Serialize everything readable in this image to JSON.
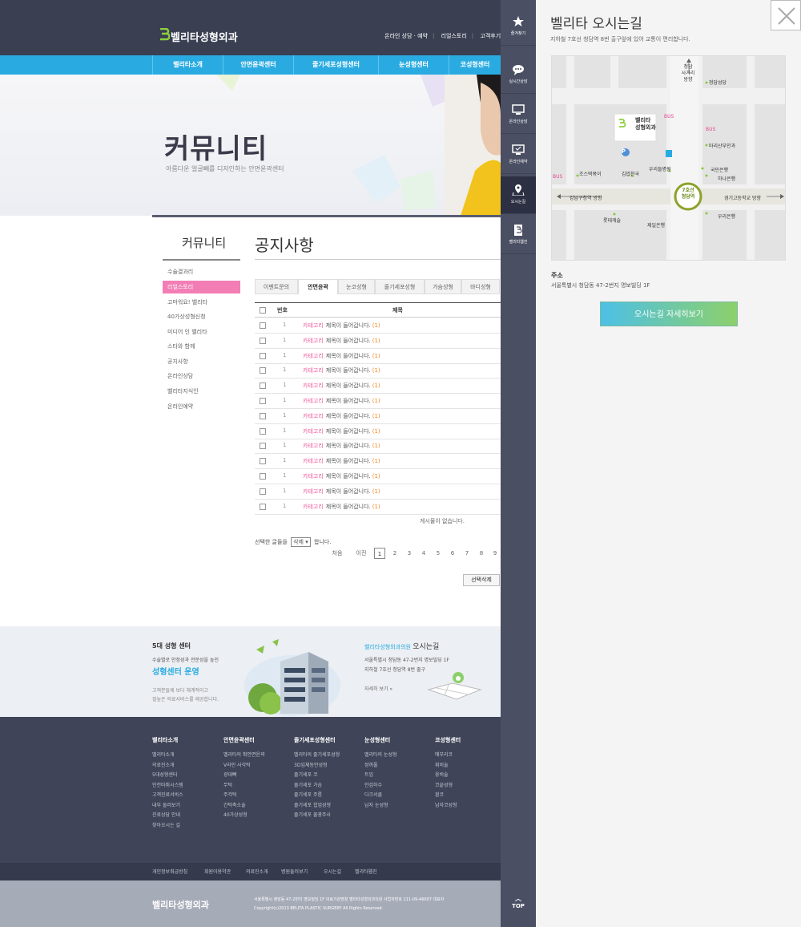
{
  "header": {
    "logo": "벨리타성형외과",
    "util": [
      "온라인 상담 · 예약",
      "리얼스토리",
      "고객후기"
    ]
  },
  "gnb": [
    "벨리타소개",
    "안면윤곽센터",
    "줄기세포성형센터",
    "눈성형센터",
    "코성형센터"
  ],
  "visual": {
    "title": "커뮤니티",
    "subtitle": "아름다운 얼굴빼를 디자인하는 안면윤곽센터"
  },
  "lnb": {
    "title": "커뮤니티",
    "items": [
      "수술결과리",
      "리얼스토리",
      "고마워요! 벨리타",
      "40가상성형신청",
      "미디어 인 벨리타",
      "스타와 함께",
      "공지사항",
      "온라인상담",
      "벨리타지식인",
      "온라인예약"
    ]
  },
  "main": {
    "page_title": "공지사항",
    "tabs": [
      "이벤트문의",
      "안면윤곽",
      "눈코성형",
      "줄기세포성형",
      "가슴성형",
      "바디성형"
    ],
    "table_header": {
      "num": "번호",
      "subject": "제목"
    },
    "rows": [
      {
        "num": "1",
        "category": "카테고리",
        "subject": "제목이 들어갑니다.",
        "count": "(1)"
      },
      {
        "num": "1",
        "category": "카테고리",
        "subject": "제목이 들어갑니다.",
        "count": "(1)"
      },
      {
        "num": "1",
        "category": "카테고리",
        "subject": "제목이 들어갑니다.",
        "count": "(1)"
      },
      {
        "num": "1",
        "category": "카테고리",
        "subject": "제목이 들어갑니다.",
        "count": "(1)"
      },
      {
        "num": "1",
        "category": "카테고리",
        "subject": "제목이 들어갑니다.",
        "count": "(1)"
      },
      {
        "num": "1",
        "category": "카테고리",
        "subject": "제목이 들어갑니다.",
        "count": "(1)"
      },
      {
        "num": "1",
        "category": "카테고리",
        "subject": "제목이 들어갑니다.",
        "count": "(1)"
      },
      {
        "num": "1",
        "category": "카테고리",
        "subject": "제목이 들어갑니다.",
        "count": "(1)"
      },
      {
        "num": "1",
        "category": "카테고리",
        "subject": "제목이 들어갑니다.",
        "count": "(1)"
      },
      {
        "num": "1",
        "category": "카테고리",
        "subject": "제목이 들어갑니다.",
        "count": "(1)"
      },
      {
        "num": "1",
        "category": "카테고리",
        "subject": "제목이 들어갑니다.",
        "count": "(1)"
      },
      {
        "num": "1",
        "category": "카테고리",
        "subject": "제목이 들어갑니다.",
        "count": "(1)"
      },
      {
        "num": "1",
        "category": "카테고리",
        "subject": "제목이 들어갑니다.",
        "count": "(1)"
      }
    ],
    "no_post": "게시물이 없습니다.",
    "select_prefix": "선택한 글들을",
    "select_value": "삭제",
    "select_suffix": "합니다.",
    "pagination": {
      "first": "처음",
      "prev": "이전",
      "pages": [
        "1",
        "2",
        "3",
        "4",
        "5",
        "6",
        "7",
        "8",
        "9"
      ],
      "current": "1"
    },
    "delete_button": "선택삭제"
  },
  "banner": {
    "left_title": "5대 성형 센터",
    "left_sub": "수술별로 안정성과 전문성을 높인",
    "left_strong": "성형센터 운영",
    "left_desc1": "고객분들께 보다 체계적이고",
    "left_desc2": "질높은 의료서비스를 제공합니다.",
    "right_brand": "벨리타성형외과의원",
    "right_title": "오시는길",
    "right_addr": "서울특별시 청담동 47-2번지 명보빌딩 1F",
    "right_sub": "지하철 7호선 청담역 8번 출구",
    "right_more": "자세히 보기  »"
  },
  "footer": {
    "cols": [
      {
        "title": "벨리타소개",
        "items": [
          "벨리타소개",
          "의료진소개",
          "5대성형센터",
          "인전마취시스템",
          "고객진료서비스",
          "내부 둘러보기",
          "진료상담 안내",
          "찾아오시는 길"
        ]
      },
      {
        "title": "안면윤곽센터",
        "items": [
          "벨리타의 확안면윤곽",
          "V라인 사각턱",
          "광대뼈",
          "무턱",
          "주걱턱",
          "간턱축소술",
          "40가상성형"
        ]
      },
      {
        "title": "줄기세포성형센터",
        "items": [
          "벨리타의 줄기세포성형",
          "3D입체동안성형",
          "줄기세포 코",
          "줄기세포 가슴",
          "줄기세포 주름",
          "줄기세포 힙업성형",
          "줄기세포 물광주사"
        ]
      },
      {
        "title": "눈성형센터",
        "items": [
          "벨리타의 눈성형",
          "쌍꺼풀",
          "트임",
          "안검하수",
          "다크서클",
          "남자 눈성형"
        ]
      },
      {
        "title": "코성형센터",
        "items": [
          "매부리코",
          "휘비술",
          "융비술",
          "코끝성형",
          "휜코",
          "남자코성형"
        ]
      }
    ],
    "nav": [
      "개인정보취급방침",
      "회원이용약관",
      "의료진소개",
      "병원둘러보기",
      "오시는길",
      "벨리타웹진"
    ],
    "logo": "벨리타성형외과",
    "address": "서울특별시 청담동 47-2번지 명보빌딩 1F    의료기관명칭 벨리타성형외과의원    사업자번호 211-09-46007    대표자",
    "copyright": "Copyright(c)2013 BELITA PLASTIC SURGERY All Rights Reserved."
  },
  "quick": {
    "items": [
      "즐겨찾기",
      "실시간상담",
      "온라인상담",
      "온라인예약",
      "오시는길",
      "벨리타웹진"
    ],
    "top": "TOP"
  },
  "panel": {
    "title": "벨리타 오시는길",
    "subtitle": "지하철 7호선 청담역 8번 출구앞에 있어 교통이 편리합니다.",
    "address_label": "주소",
    "address": "서울특별시 청담동 47-2번지 명보빌딩 1F",
    "button": "오시는길 자세히보기",
    "map": {
      "north_label": [
        "청담",
        "사거리",
        "방향"
      ],
      "clinic": [
        "벨리타",
        "성형외과"
      ],
      "labels": [
        "청담성당",
        "마리산부인과",
        "국민은행",
        "하나은행",
        "조스떡볶이",
        "김밥천국",
        "우리들병원",
        "롯데캐슬",
        "제일은행",
        "우리은행"
      ],
      "bus": "BUS",
      "parking": "P",
      "station": [
        "7호선",
        "청담역"
      ],
      "left_road": "강남구청역 방향",
      "right_road": "경기고등학교 방향"
    }
  }
}
